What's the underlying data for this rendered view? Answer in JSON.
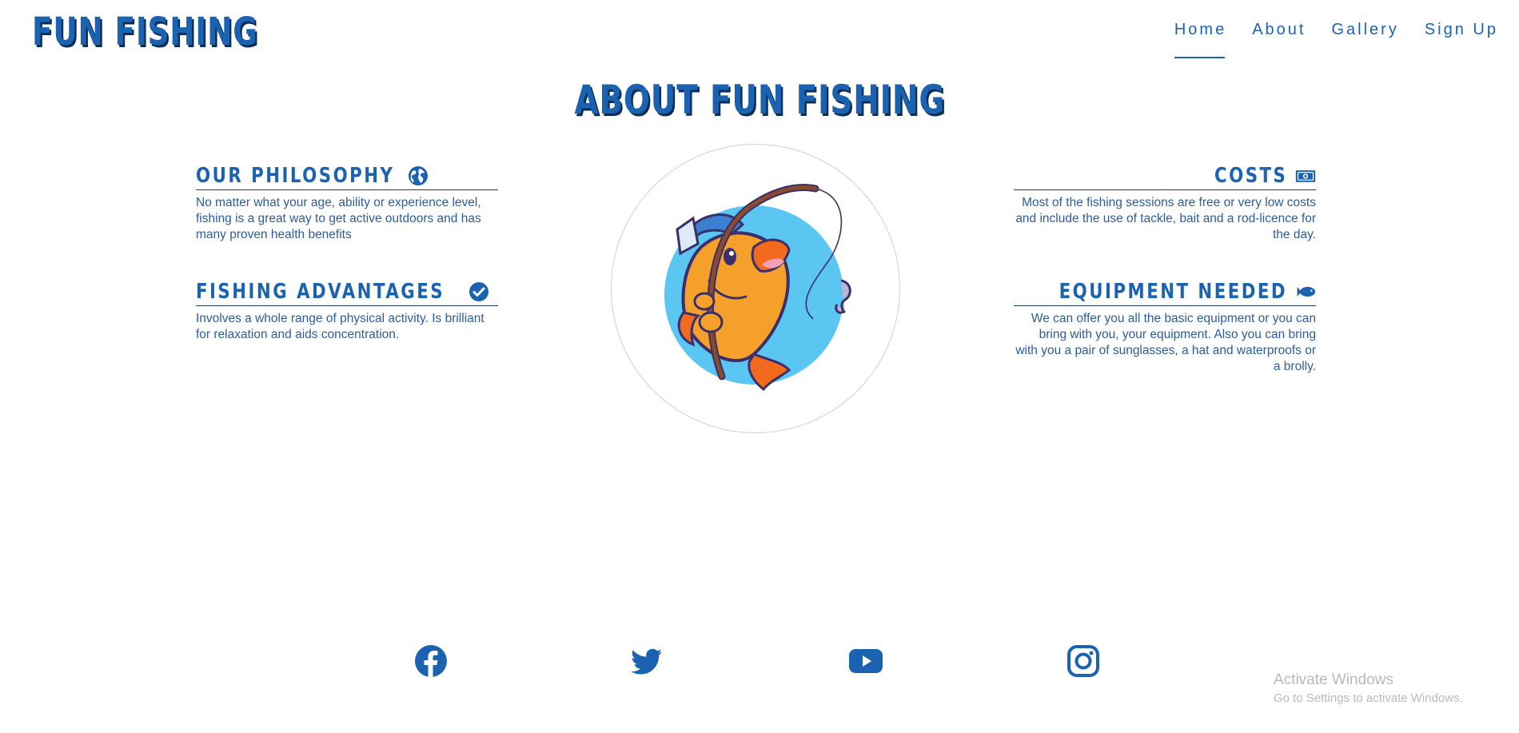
{
  "header": {
    "brand": "FUN FISHING",
    "nav": [
      {
        "label": "Home"
      },
      {
        "label": "About"
      },
      {
        "label": "Gallery"
      },
      {
        "label": "Sign Up"
      }
    ]
  },
  "main": {
    "title": "ABOUT FUN FISHING",
    "features": [
      {
        "heading": "OUR PHILOSOPHY",
        "icon": "globe-icon",
        "text": "No matter what your age, ability or experience level, fishing is a great way to get active outdoors and has many proven health benefits"
      },
      {
        "heading": "FISHING ADVANTAGES",
        "icon": "check-circle-icon",
        "text": "Involves a whole range of physical activity. Is brilliant for relaxation and aids concentration."
      },
      {
        "heading": "COSTS",
        "icon": "money-icon",
        "text": "Most of the fishing sessions are free or very low costs and include the use of tackle, bait and a rod-licence for the day."
      },
      {
        "heading": "EQUIPMENT NEEDED",
        "icon": "fish-icon",
        "text": "We can offer you all the basic equipment or you can bring with you, your equipment. Also you can bring with you a pair of sunglasses, a hat and waterproofs or a brolly."
      }
    ],
    "mascot": {
      "icon": "fishing-fish-mascot-illustration"
    }
  },
  "footer": {
    "social": [
      {
        "icon": "facebook-icon"
      },
      {
        "icon": "twitter-icon"
      },
      {
        "icon": "youtube-icon"
      },
      {
        "icon": "instagram-icon"
      }
    ]
  },
  "overlay": {
    "title": "Activate Windows",
    "subtitle": "Go to Settings to activate Windows."
  },
  "colors": {
    "brand_blue": "#1b63b0",
    "shadow_navy": "#0c2d57",
    "mascot_bg": "#5bc6f2",
    "fish_orange": "#f5a02a"
  }
}
